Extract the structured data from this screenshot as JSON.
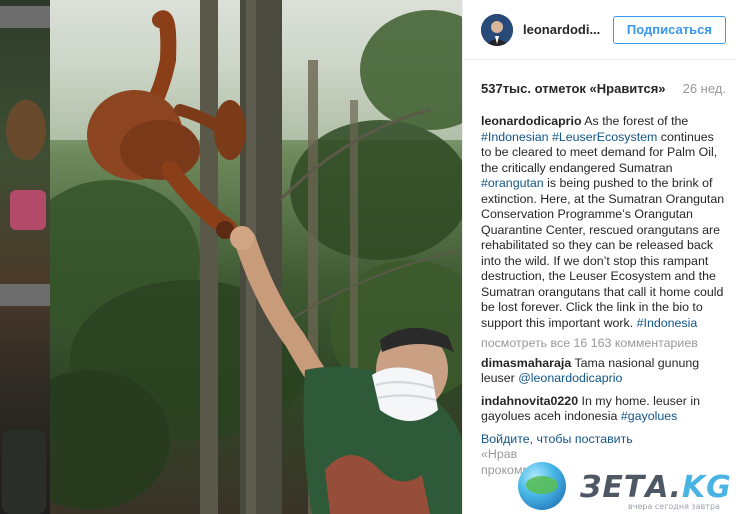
{
  "header": {
    "username": "leonardodi...",
    "follow_label": "Подписаться"
  },
  "post": {
    "likes": "537тыс. отметок «Нравится»",
    "age": "26 нед."
  },
  "caption": {
    "author": "leonardodicaprio",
    "parts": [
      " As the forest of the ",
      "#Indonesian",
      " ",
      "#LeuserEcosystem",
      " continues to be cleared to meet demand for Palm Oil, the critically endangered Sumatran ",
      "#orangutan",
      " is being pushed to the brink of extinction. Here, at the Sumatran Orangutan Conservation Programme’s Orangutan Quarantine Center, rescued orangutans are rehabilitated so they can be released back into the wild. If we don’t stop this rampant destruction, the Leuser Ecosystem and the Sumatran orangutans that call it home could be lost forever. Click the link in the bio to support this important work. ",
      "#Indonesia"
    ]
  },
  "view_all": "посмотреть все 16 163 комментариев",
  "comments": [
    {
      "author": "dimasmaharaja",
      "text": " Tama nasional gunung leuser ",
      "mention": "@leonardodicaprio"
    },
    {
      "author": "indahnovita0220",
      "text": " In my home. leuser in gayolues aceh indonesia ",
      "mention": "#gayolues"
    }
  ],
  "footer_fragments": {
    "line1": "Войдите, чтобы поставить",
    "line2": "«Нрав",
    "line3": "прокомм"
  },
  "watermark": {
    "brand": "ЗЕТА.",
    "tld": "KG",
    "tagline": "вчера сегодня завтра"
  },
  "colors": {
    "accent": "#3897f0",
    "link": "#125688",
    "muted": "#999999"
  }
}
